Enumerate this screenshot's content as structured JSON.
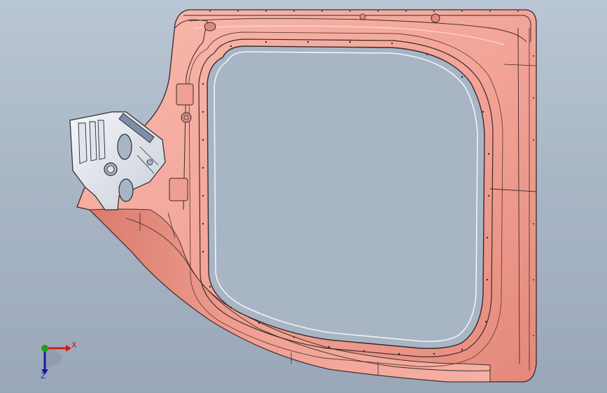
{
  "viewport": {
    "title": "",
    "background_top": "#b9c6d4",
    "background_bottom": "#9aa7b8"
  },
  "model": {
    "name": "door-inner-panel",
    "panel_color": "#f2a79a",
    "panel_shadow": "#d9786a",
    "bracket_color": "#e8ecf2",
    "edge_color": "#3a2a2a"
  },
  "triad": {
    "x_label": "X",
    "z_label": "Z",
    "x_color": "#d41a1a",
    "y_color": "#1aa01a",
    "z_color": "#1a1aa0"
  }
}
